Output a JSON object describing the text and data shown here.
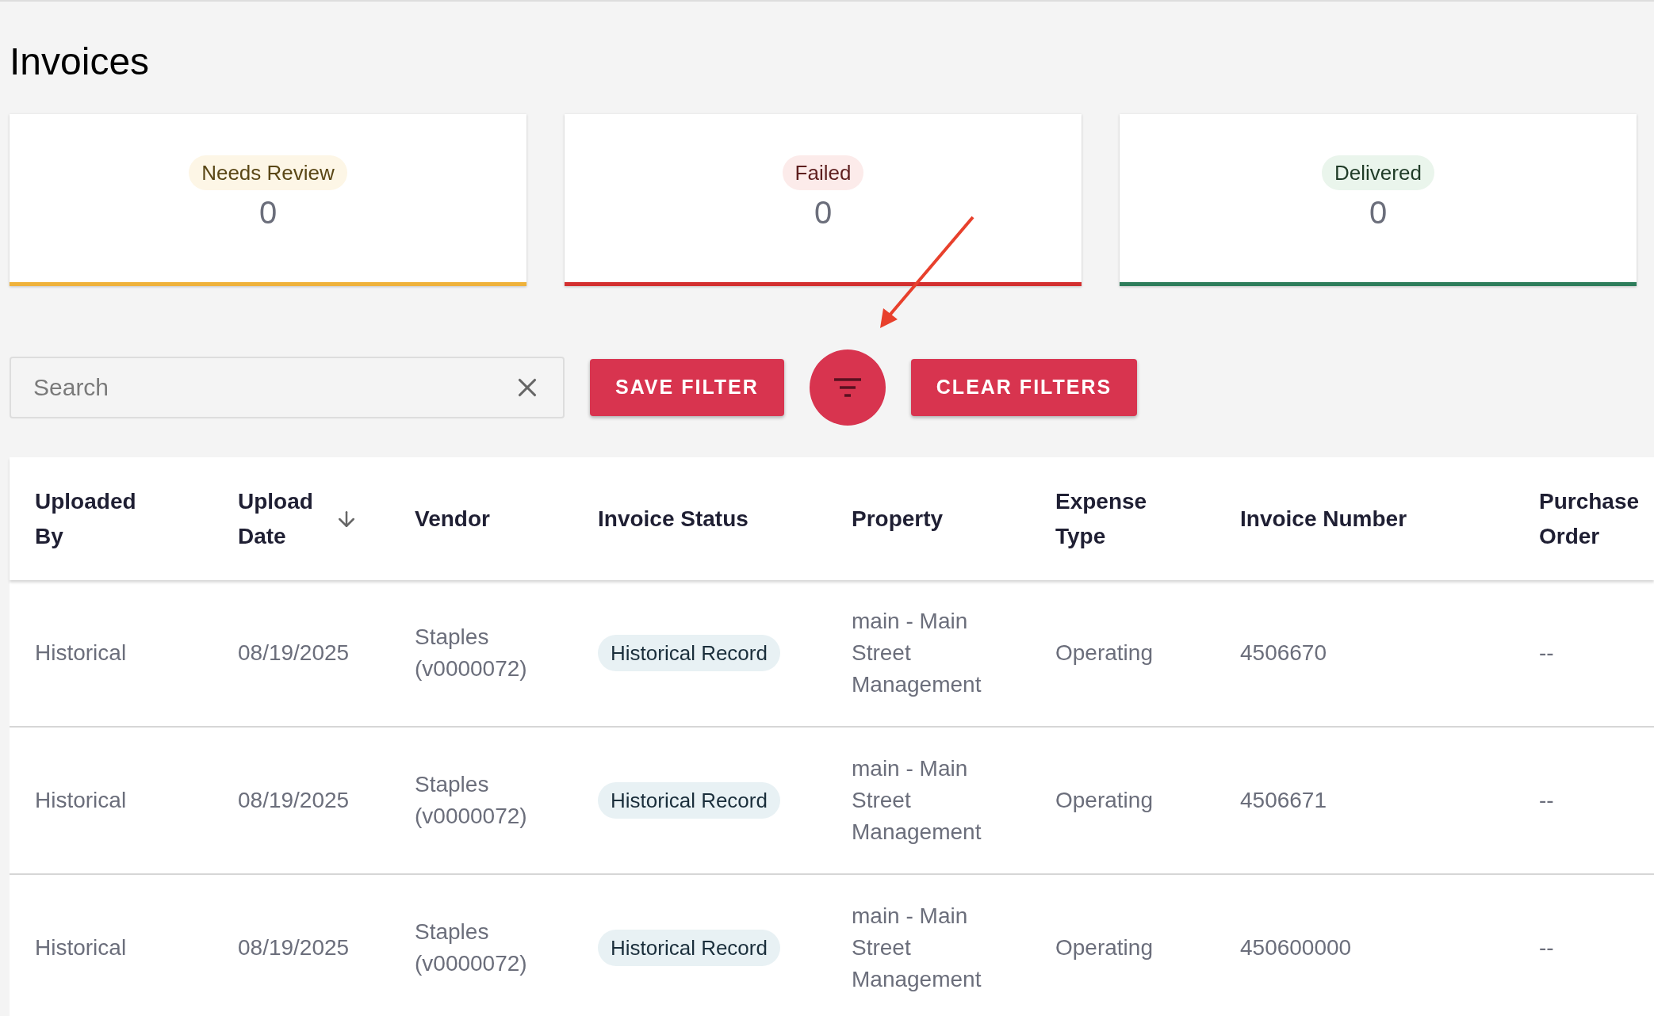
{
  "page_title": "Invoices",
  "status_cards": [
    {
      "label": "Needs Review",
      "count": "0",
      "kind": "warning"
    },
    {
      "label": "Failed",
      "count": "0",
      "kind": "error"
    },
    {
      "label": "Delivered",
      "count": "0",
      "kind": "success"
    }
  ],
  "toolbar": {
    "search": {
      "placeholder": "Search"
    },
    "save_filter": "SAVE FILTER",
    "clear_filters": "CLEAR FILTERS"
  },
  "annotation": {
    "kind": "arrow"
  },
  "table": {
    "columns": [
      {
        "label": "Uploaded By",
        "sorted": false
      },
      {
        "label": "Upload Date",
        "sorted": true
      },
      {
        "label": "Vendor",
        "sorted": false
      },
      {
        "label": "Invoice Status",
        "sorted": false
      },
      {
        "label": "Property",
        "sorted": false
      },
      {
        "label": "Expense Type",
        "sorted": false
      },
      {
        "label": "Invoice Number",
        "sorted": false
      },
      {
        "label": "Purchase Order",
        "sorted": false
      }
    ],
    "rows": [
      [
        "Historical",
        "08/19/2025",
        "Staples (v0000072)",
        "Historical Record",
        "main - Main Street Management",
        "Operating",
        "4506670",
        "--"
      ],
      [
        "Historical",
        "08/19/2025",
        "Staples (v0000072)",
        "Historical Record",
        "main - Main Street Management",
        "Operating",
        "4506671",
        "--"
      ],
      [
        "Historical",
        "08/19/2025",
        "Staples (v0000072)",
        "Historical Record",
        "main - Main Street Management",
        "Operating",
        "450600000",
        "--"
      ]
    ]
  }
}
